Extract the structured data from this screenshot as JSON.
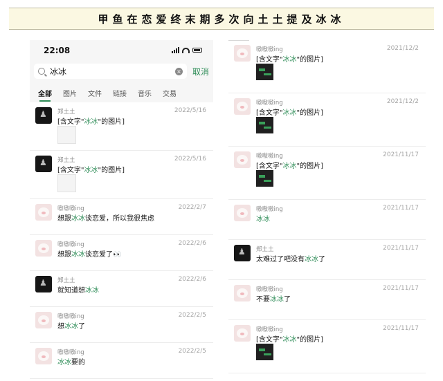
{
  "banner": {
    "title": "甲鱼在恋爱终末期多次向土土提及冰冰"
  },
  "phone": {
    "status_time": "22:08",
    "search_value": "冰冰",
    "clear_glyph": "×",
    "cancel_label": "取消",
    "tabs": [
      "全部",
      "图片",
      "文件",
      "链接",
      "音乐",
      "交易"
    ],
    "active_tab": "全部"
  },
  "left_results": [
    {
      "avatar": "dark",
      "name": "郑土土",
      "date": "2022/5/16",
      "pre": "[含文字\"",
      "hl": "冰冰",
      "post": "\"的图片]",
      "thumb": "white"
    },
    {
      "avatar": "dark",
      "name": "郑土土",
      "date": "2022/5/16",
      "pre": "[含文字\"",
      "hl": "冰冰",
      "post": "\"的图片]",
      "thumb": "white"
    },
    {
      "avatar": "pig",
      "name": "嗷嗷嗷ing",
      "date": "2022/2/7",
      "pre": "想跟",
      "hl": "冰冰",
      "post": "谈恋爱，所以我很焦虑"
    },
    {
      "avatar": "pig",
      "name": "嗷嗷嗷ing",
      "date": "2022/2/6",
      "pre": "想跟",
      "hl": "冰冰",
      "post": "谈恋爱了👀"
    },
    {
      "avatar": "dark",
      "name": "郑土土",
      "date": "2022/2/6",
      "pre": "就知道想",
      "hl": "冰冰",
      "post": ""
    },
    {
      "avatar": "pig",
      "name": "嗷嗷嗷ing",
      "date": "2022/2/5",
      "pre": "想",
      "hl": "冰冰",
      "post": "了"
    },
    {
      "avatar": "pig",
      "name": "嗷嗷嗷ing",
      "date": "2022/2/5",
      "pre": "",
      "hl": "冰冰",
      "post": "要的"
    }
  ],
  "right_results": [
    {
      "avatar": "pig",
      "name": "嗷嗷嗷ing",
      "date": "2021/12/2",
      "pre": "[含文字\"",
      "hl": "冰冰",
      "post": "\"的图片]",
      "thumb": "dark"
    },
    {
      "avatar": "pig",
      "name": "嗷嗷嗷ing",
      "date": "2021/12/2",
      "pre": "[含文字\"",
      "hl": "冰冰",
      "post": "\"的图片]",
      "thumb": "dark"
    },
    {
      "avatar": "pig",
      "name": "嗷嗷嗷ing",
      "date": "2021/11/17",
      "pre": "[含文字\"",
      "hl": "冰冰",
      "post": "\"的图片]",
      "thumb": "dark"
    },
    {
      "avatar": "pig",
      "name": "嗷嗷嗷ing",
      "date": "2021/11/17",
      "pre": "",
      "hl": "冰冰",
      "post": ""
    },
    {
      "avatar": "dark",
      "name": "郑土土",
      "date": "2021/11/17",
      "pre": "太难过了吧没有",
      "hl": "冰冰",
      "post": "了"
    },
    {
      "avatar": "pig",
      "name": "嗷嗷嗷ing",
      "date": "2021/11/17",
      "pre": "不要",
      "hl": "冰冰",
      "post": "了"
    },
    {
      "avatar": "pig",
      "name": "嗷嗷嗷ing",
      "date": "2021/11/17",
      "pre": "[含文字\"",
      "hl": "冰冰",
      "post": "\"的图片]",
      "thumb": "dark"
    }
  ]
}
